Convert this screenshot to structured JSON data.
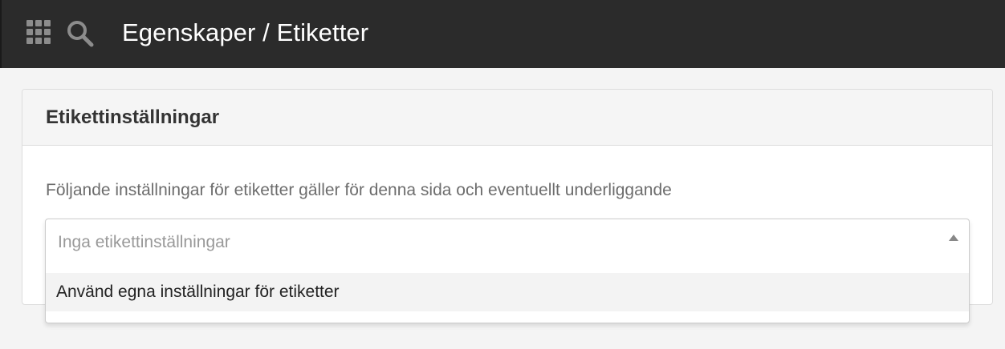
{
  "header": {
    "title": "Egenskaper / Etiketter",
    "apps_icon": "grid-apps-icon",
    "search_icon": "search-icon",
    "background": "#2b2b2b"
  },
  "panel": {
    "title": "Etikettinställningar",
    "description": "Följande inställningar för etiketter gäller för denna sida och eventuellt underliggande"
  },
  "select": {
    "placeholder": "Inga etikettinställningar",
    "expanded": true,
    "arrow_icon": "triangle-up-icon",
    "options": [
      {
        "label": "Använd egna inställningar för etiketter",
        "highlighted": true
      }
    ]
  }
}
